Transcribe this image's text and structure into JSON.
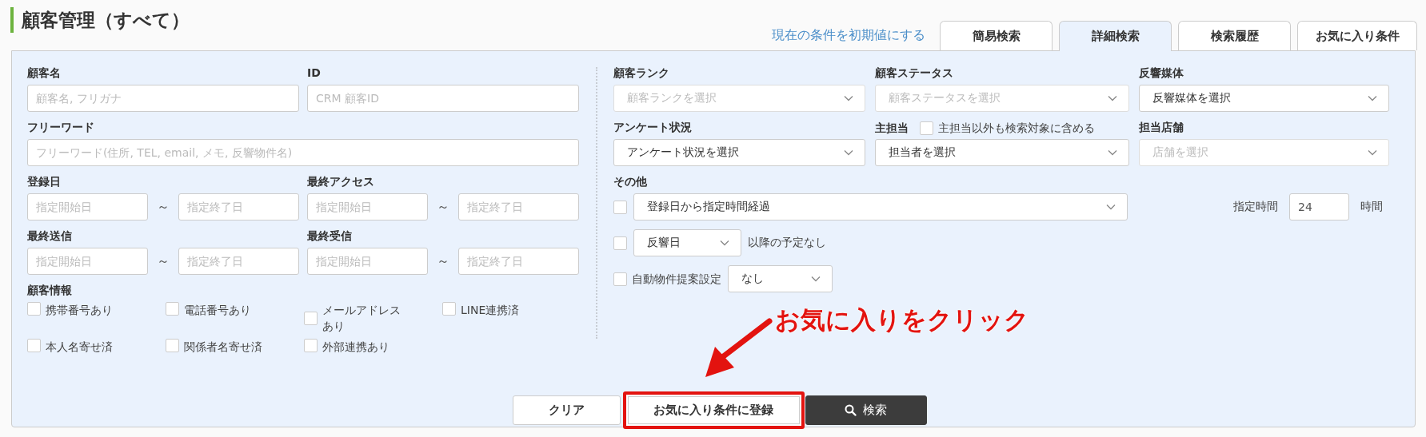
{
  "page_title": "顧客管理（すべて）",
  "reset_link": "現在の条件を初期値にする",
  "tabs": [
    {
      "label": "簡易検索",
      "selected": false
    },
    {
      "label": "詳細検索",
      "selected": true
    },
    {
      "label": "検索履歴",
      "selected": false
    },
    {
      "label": "お気に入り条件",
      "selected": false
    }
  ],
  "customer_name": {
    "label": "顧客名",
    "placeholder": "顧客名, フリガナ"
  },
  "id": {
    "label": "ID",
    "placeholder": "CRM 顧客ID"
  },
  "free_word": {
    "label": "フリーワード",
    "placeholder": "フリーワード(住所, TEL, email, メモ, 反響物件名)"
  },
  "date_ranges": [
    {
      "label": "登録日",
      "start_placeholder": "指定開始日",
      "separator": "～",
      "end_placeholder": "指定終了日"
    },
    {
      "label": "最終アクセス",
      "start_placeholder": "指定開始日",
      "separator": "～",
      "end_placeholder": "指定終了日"
    },
    {
      "label": "最終送信",
      "start_placeholder": "指定開始日",
      "separator": "～",
      "end_placeholder": "指定終了日"
    },
    {
      "label": "最終受信",
      "start_placeholder": "指定開始日",
      "separator": "～",
      "end_placeholder": "指定終了日"
    }
  ],
  "customer_info": {
    "label": "顧客情報",
    "options": [
      {
        "label": "携帯番号あり",
        "checked": false
      },
      {
        "label": "電話番号あり",
        "checked": false
      },
      {
        "label": "メールアドレスあり",
        "checked": false
      },
      {
        "label": "LINE連携済",
        "checked": false
      },
      {
        "label": "本人名寄せ済",
        "checked": false
      },
      {
        "label": "関係者名寄せ済",
        "checked": false
      },
      {
        "label": "外部連携あり",
        "checked": false
      }
    ]
  },
  "selects": [
    {
      "label": "顧客ランク",
      "text": "顧客ランクを選択",
      "disabled": true
    },
    {
      "label": "顧客ステータス",
      "text": "顧客ステータスを選択",
      "disabled": true
    },
    {
      "label": "反響媒体",
      "text": "反響媒体を選択",
      "disabled": false
    },
    {
      "label": "アンケート状況",
      "text": "アンケート状況を選択",
      "disabled": false
    },
    {
      "label": "主担当",
      "text": "担当者を選択",
      "disabled": false,
      "extra_option": {
        "label": "主担当以外も検索対象に含める",
        "checked": false
      }
    },
    {
      "label": "担当店舗",
      "text": "店舗を選択",
      "disabled": true
    }
  ],
  "other": {
    "label": "その他",
    "rows": [
      {
        "kind": "elapsed",
        "checked": false,
        "select": "登録日から指定時間経過",
        "hours_label": "指定時間",
        "hours_value": "24",
        "hours_unit": "時間"
      },
      {
        "kind": "no_plan",
        "checked": false,
        "select": "反響日",
        "suffix": "以降の予定なし"
      },
      {
        "kind": "auto_proposal",
        "checked": false,
        "label": "自動物件提案設定",
        "select": "なし"
      }
    ]
  },
  "buttons": [
    {
      "label": "クリア",
      "kind": "plain",
      "highlighted": false
    },
    {
      "label": "お気に入り条件に登録",
      "kind": "plain",
      "highlighted": true
    },
    {
      "label": "検索",
      "kind": "primary",
      "highlighted": false
    }
  ],
  "annotation": {
    "text": "お気に入りをクリック"
  }
}
